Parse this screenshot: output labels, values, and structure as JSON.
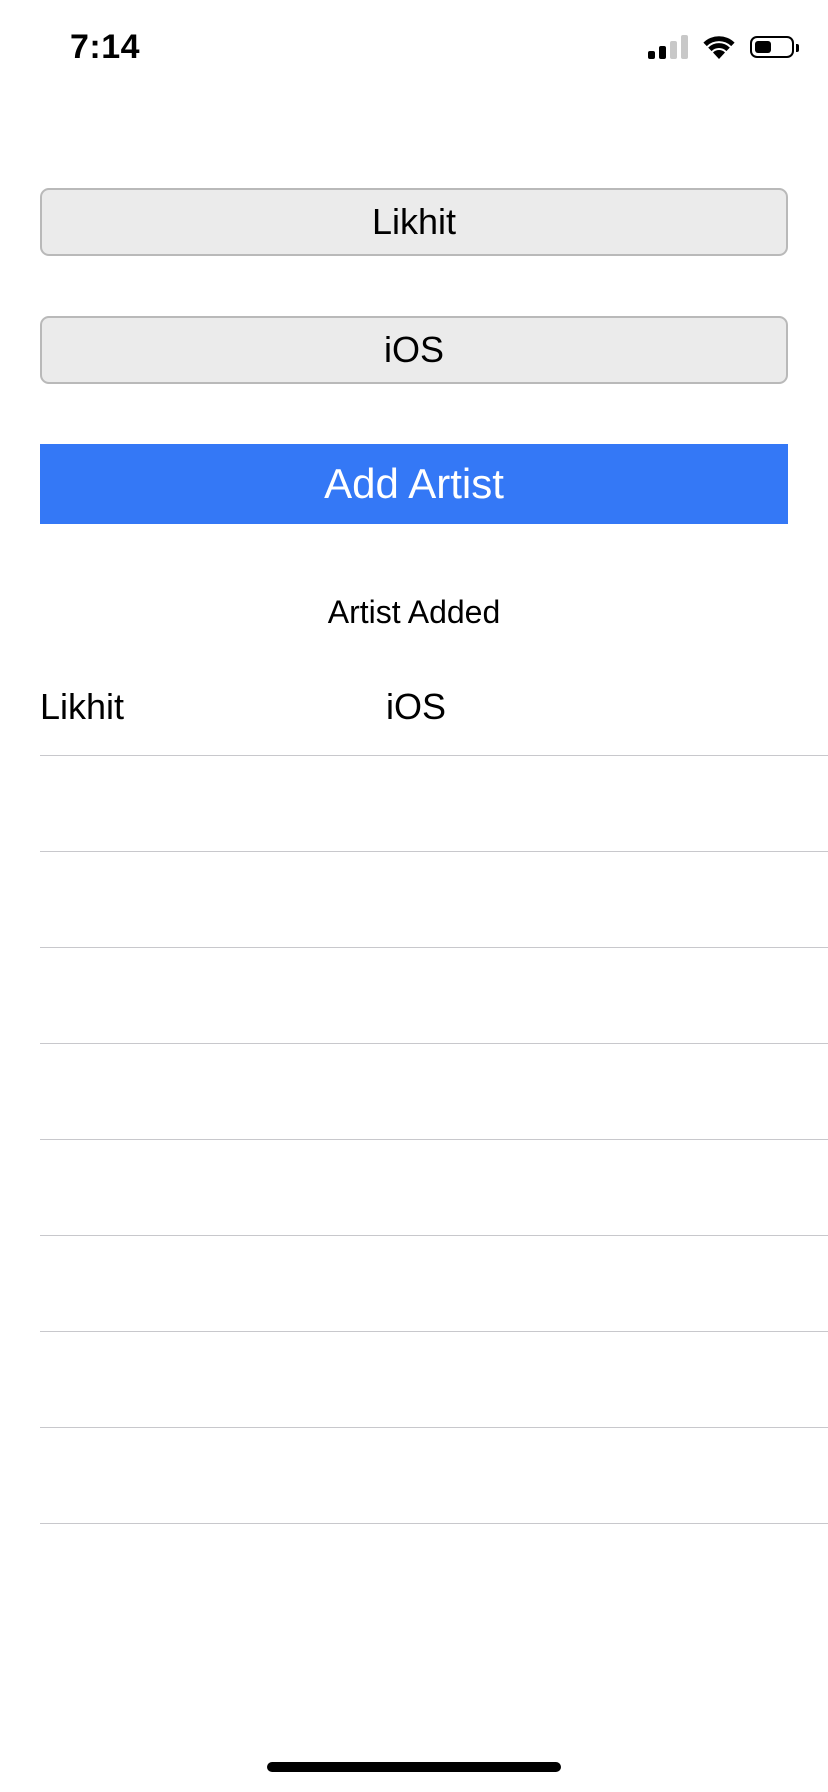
{
  "status_bar": {
    "time": "7:14",
    "icons": [
      "cellular-signal-icon",
      "wifi-icon",
      "battery-icon"
    ],
    "signal_bars": 2,
    "signal_bars_total": 4,
    "battery_level": 0.5
  },
  "form": {
    "name_value": "Likhit",
    "genre_value": "iOS",
    "add_button_label": "Add Artist",
    "add_button_color": "#3478f6"
  },
  "status_message": "Artist Added",
  "table": {
    "rows": [
      {
        "name": "Likhit",
        "genre": "iOS"
      },
      {
        "name": "",
        "genre": ""
      },
      {
        "name": "",
        "genre": ""
      },
      {
        "name": "",
        "genre": ""
      },
      {
        "name": "",
        "genre": ""
      },
      {
        "name": "",
        "genre": ""
      },
      {
        "name": "",
        "genre": ""
      },
      {
        "name": "",
        "genre": ""
      },
      {
        "name": "",
        "genre": ""
      }
    ]
  }
}
